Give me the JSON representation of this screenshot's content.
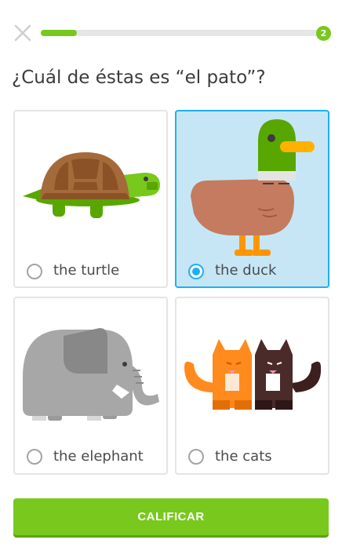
{
  "header": {
    "close_icon": "close-icon",
    "progress": {
      "fraction": 0.13,
      "badge": "2",
      "fill_color": "#78c81e"
    }
  },
  "question": "¿Cuál de éstas es “el pato”?",
  "options": [
    {
      "label": "the turtle",
      "icon": "turtle-icon",
      "selected": false
    },
    {
      "label": "the duck",
      "icon": "duck-icon",
      "selected": true
    },
    {
      "label": "the elephant",
      "icon": "elephant-icon",
      "selected": false
    },
    {
      "label": "the cats",
      "icon": "cats-icon",
      "selected": false
    }
  ],
  "check_button": {
    "label": "CALIFICAR"
  },
  "colors": {
    "accent_green": "#78c81e",
    "selected_blue": "#1cb0f6",
    "selected_bg": "#c6e6f6"
  }
}
